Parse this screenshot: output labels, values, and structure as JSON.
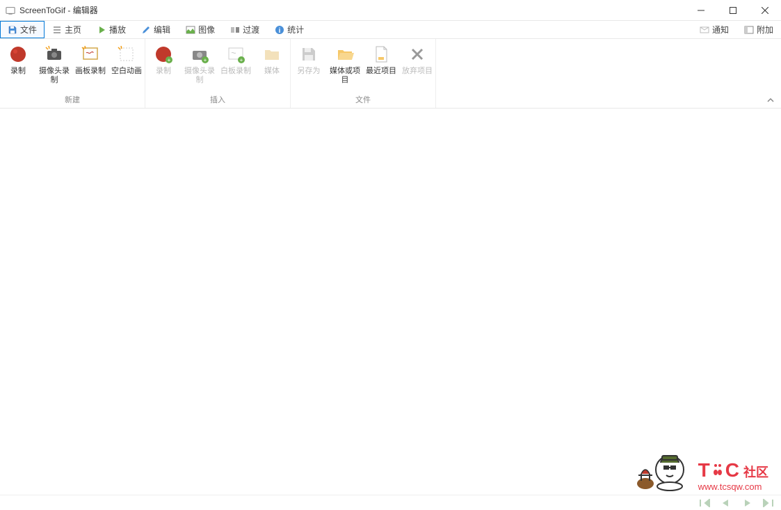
{
  "window": {
    "title": "ScreenToGif - 编辑器"
  },
  "tabs": {
    "file": "文件",
    "home": "主页",
    "play": "播放",
    "edit": "编辑",
    "image": "图像",
    "transition": "过渡",
    "stats": "统计",
    "notify": "通知",
    "attach": "附加"
  },
  "ribbon": {
    "groups": {
      "new": "新建",
      "insert": "插入",
      "file": "文件"
    },
    "buttons": {
      "record": "录制",
      "webcam": "摄像头录制",
      "board": "画板录制",
      "blank": "空白动画",
      "record2": "录制",
      "webcam2": "摄像头录制",
      "whiteboard": "白板录制",
      "media": "媒体",
      "saveas": "另存为",
      "mediaproj": "媒体或项目",
      "recent": "最近项目",
      "discard": "放弃项目"
    }
  },
  "watermark": {
    "t": "T",
    "c": "C",
    "community": "社区",
    "url": "www.tcsqw.com"
  }
}
